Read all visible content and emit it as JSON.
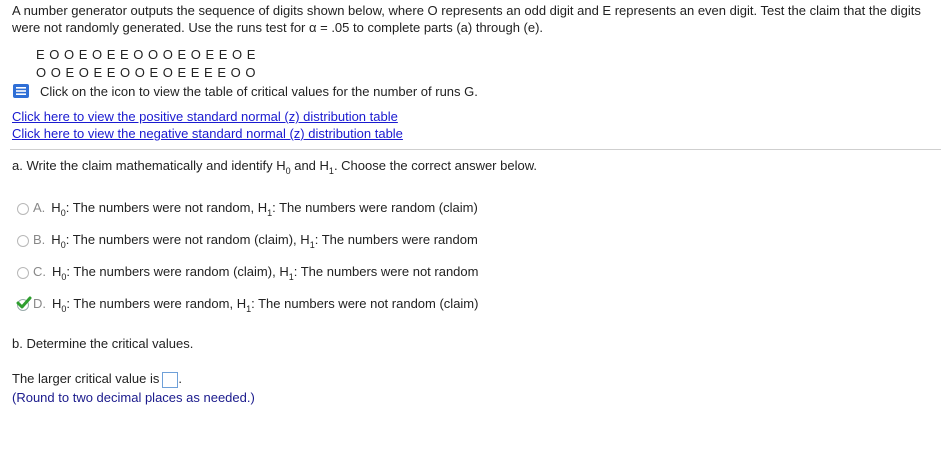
{
  "problem": {
    "intro": "A number generator outputs the sequence of digits shown below, where O represents an odd digit and E represents an even digit. Test the claim that the digits were not randomly generated. Use the runs test for α = .05 to complete parts (a) through (e).",
    "sequence_line1": "E O O E O E E O O O E O E E O E",
    "sequence_line2": "O O E O E E O O E O E E E E O O",
    "table_text": "Click on the icon to view the table of critical values for the number of runs G.",
    "link_positive": "Click here to view the positive standard normal (z) distribution table",
    "link_negative": "Click here to view the negative standard normal (z) distribution table"
  },
  "part_a": {
    "question": "a. Write the claim mathematically and identify H",
    "question_sub0": "0",
    "question_mid": " and H",
    "question_sub1": "1",
    "question_end": ". Choose the correct answer below.",
    "options": [
      {
        "letter": "A.",
        "h0": "The numbers were not random,",
        "h1": "The numbers were random (claim)"
      },
      {
        "letter": "B.",
        "h0": "The numbers were not random (claim),",
        "h1": "The numbers were random"
      },
      {
        "letter": "C.",
        "h0": "The numbers were random (claim),",
        "h1": "The numbers were not random"
      },
      {
        "letter": "D.",
        "h0": "The numbers were random,",
        "h1": "The numbers were not random (claim)"
      }
    ],
    "selected": "D"
  },
  "part_b": {
    "question": "b. Determine the critical values.",
    "answer_label": "The larger critical value is",
    "answer_value": "",
    "hint": "(Round to two decimal places as needed.)"
  },
  "colors": {
    "link": "#1a1ad0",
    "check": "#2e9e2e",
    "hint": "#1a1a8c"
  }
}
